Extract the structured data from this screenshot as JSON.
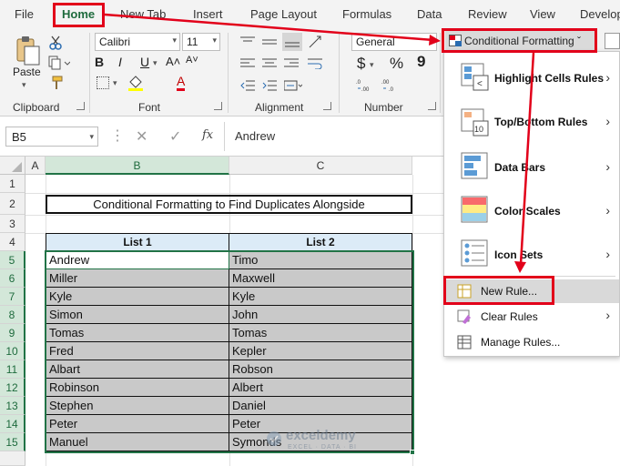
{
  "menu_tabs": [
    "File",
    "Home",
    "New Tab",
    "Insert",
    "Page Layout",
    "Formulas",
    "Data",
    "Review",
    "View",
    "Develop"
  ],
  "ribbon": {
    "clipboard": {
      "label": "Clipboard",
      "paste": "Paste"
    },
    "font": {
      "label": "Font",
      "name": "Calibri",
      "size": "11",
      "grow": "A˄",
      "shrink": "A˅",
      "bold": "B",
      "italic": "I",
      "underline": "U",
      "font_color": "A"
    },
    "alignment": {
      "label": "Alignment"
    },
    "number": {
      "label": "Number",
      "format": "General",
      "currency": "$",
      "percent": "%",
      "comma": "9"
    },
    "cf_button": "Conditional Formatting ˇ"
  },
  "formula_bar": {
    "name_box": "B5",
    "fx": "fx",
    "value": "Andrew"
  },
  "grid": {
    "columns": [
      "A",
      "B",
      "C"
    ],
    "rows": [
      "1",
      "2",
      "3",
      "4",
      "5",
      "6",
      "7",
      "8",
      "9",
      "10",
      "11",
      "12",
      "13",
      "14",
      "15"
    ],
    "title": "Conditional Formatting to Find Duplicates Alongside",
    "headers": [
      "List 1",
      "List 2"
    ],
    "list1": [
      "Andrew",
      "Miller",
      "Kyle",
      "Simon",
      "Tomas",
      "Fred",
      "Albart",
      "Robinson",
      "Stephen",
      "Peter",
      "Manuel"
    ],
    "list2": [
      "Timo",
      "Maxwell",
      "Kyle",
      "John",
      "Tomas",
      "Kepler",
      "Robson",
      "Albert",
      "Daniel",
      "Peter",
      "Symonds"
    ]
  },
  "cf_menu": {
    "items": [
      {
        "label": "Highlight Cells Rules",
        "icon": "highlight-cells-icon"
      },
      {
        "label": "Top/Bottom Rules",
        "icon": "top-bottom-icon"
      },
      {
        "label": "Data Bars",
        "icon": "data-bars-icon"
      },
      {
        "label": "Color Scales",
        "icon": "color-scales-icon"
      },
      {
        "label": "Icon Sets",
        "icon": "icon-sets-icon"
      }
    ],
    "new_rule": "New Rule...",
    "clear_rules": "Clear Rules",
    "manage_rules": "Manage Rules..."
  },
  "watermark": {
    "brand": "exceldemy",
    "tagline": "EXCEL · DATA · BI"
  },
  "colors": {
    "accent_red": "#e2001a",
    "excel_green": "#217346",
    "header_fill": "#dcebf7",
    "data_fill": "#c9c9c9"
  }
}
